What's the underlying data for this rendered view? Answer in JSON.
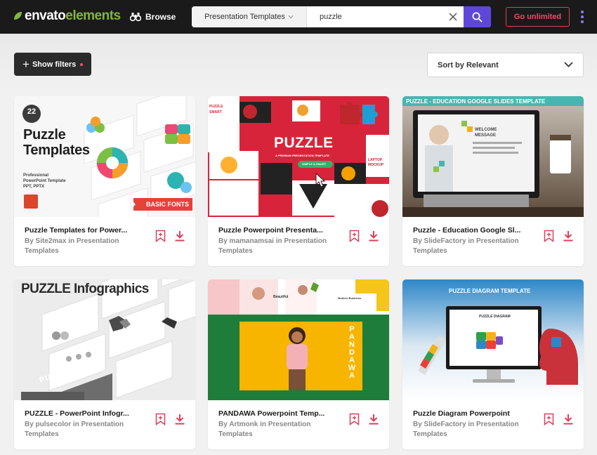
{
  "header": {
    "logo_text_1": "envato",
    "logo_text_2": "elements",
    "browse_label": "Browse",
    "search_category": "Presentation Templates",
    "search_value": "puzzle",
    "go_unlimited_label": "Go unlimited",
    "colors": {
      "bar": "#1a1a1a",
      "search_button": "#5e47d8",
      "accent_red": "#e03e5b",
      "brand_green": "#82b541"
    }
  },
  "toolbar": {
    "show_filters_label": "Show filters",
    "sort_label": "Sort by Relevant"
  },
  "cards": [
    {
      "title": "Puzzle Templates for Power...",
      "meta": "By Site2max in Presentation Templates",
      "thumb_text": {
        "badge": "22",
        "heading_1": "Puzzle",
        "heading_2": "Templates",
        "sub_1": "Professional",
        "sub_2": "PowerPoint Template",
        "sub_3": "PPT, PPTX",
        "ribbon": "BASIC FONTS"
      }
    },
    {
      "title": "Puzzle Powerpoint Presenta...",
      "meta": "By mamanamsai in Presentation Templates",
      "thumb_text": {
        "heading": "PUZZLE",
        "sub": "A PREMIUM PRESENTATION TEMPLATE",
        "button": "SIMPLE & SMART",
        "side_label_1": "PUZZLE",
        "side_label_2": "SMART",
        "side_label_3": "LAPTOP",
        "side_label_4": "MOCKUP"
      }
    },
    {
      "title": "Puzzle - Education Google Sl...",
      "meta": "By SlideFactory in Presentation Templates",
      "thumb_text": {
        "heading": "PUZZLE - EDUCATION GOOGLE SLIDES TEMPLATE",
        "screen_1": "WELCOME",
        "screen_2": "MESSAGE"
      }
    },
    {
      "title": "PUZZLE - PowerPoint Infogr...",
      "meta": "By pulsecolor in Presentation Templates",
      "thumb_text": {
        "heading": "PUZZLE Infographics",
        "footer": "PUZZLE"
      }
    },
    {
      "title": "PANDAWA Powerpoint Temp...",
      "meta": "By Artmonk in Presentation Templates",
      "thumb_text": {
        "vertical": "PANDAWA",
        "label_1": "Beautiful",
        "label_2": "Modern Business"
      }
    },
    {
      "title": "Puzzle Diagram Powerpoint",
      "meta": "By SlideFactory in Presentation Templates",
      "thumb_text": {
        "heading": "PUZZLE DIAGRAM TEMPLATE",
        "screen": "PUZZLE DIAGRAM"
      }
    }
  ]
}
